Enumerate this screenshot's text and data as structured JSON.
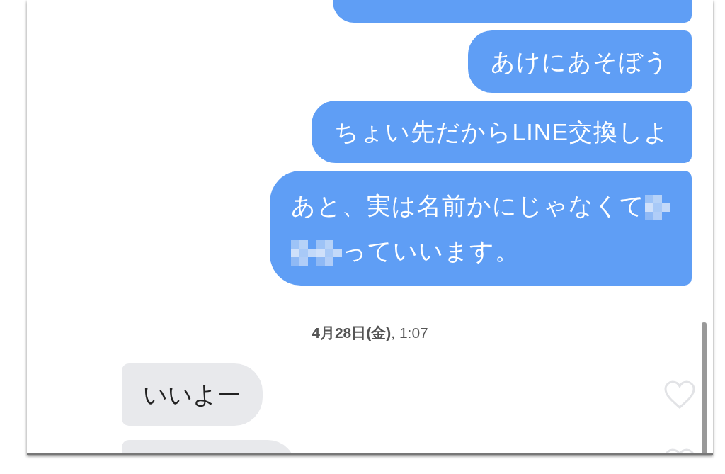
{
  "messages": [
    {
      "kind": "partial"
    },
    {
      "kind": "sent",
      "lines": [
        [
          {
            "kind": "text",
            "text": "あけにあそぼう"
          }
        ]
      ]
    },
    {
      "kind": "sent",
      "lines": [
        [
          {
            "kind": "text",
            "text": "ちょい先だからLINE交換しよ"
          }
        ]
      ]
    },
    {
      "kind": "sent",
      "lines": [
        [
          {
            "kind": "text",
            "text": "あと、実は名前かにじゃなくて"
          },
          {
            "kind": "mosaic"
          }
        ],
        [
          {
            "kind": "mosaic"
          },
          {
            "kind": "mosaic"
          },
          {
            "kind": "text",
            "text": "っていいます。"
          }
        ]
      ]
    },
    {
      "kind": "timestamp",
      "text": "**4月28日(金)**, 1:07"
    },
    {
      "kind": "received",
      "liked": false,
      "lines": [
        [
          {
            "kind": "text",
            "text": "いいよー"
          }
        ]
      ]
    },
    {
      "kind": "received_cut",
      "liked": false
    }
  ]
}
